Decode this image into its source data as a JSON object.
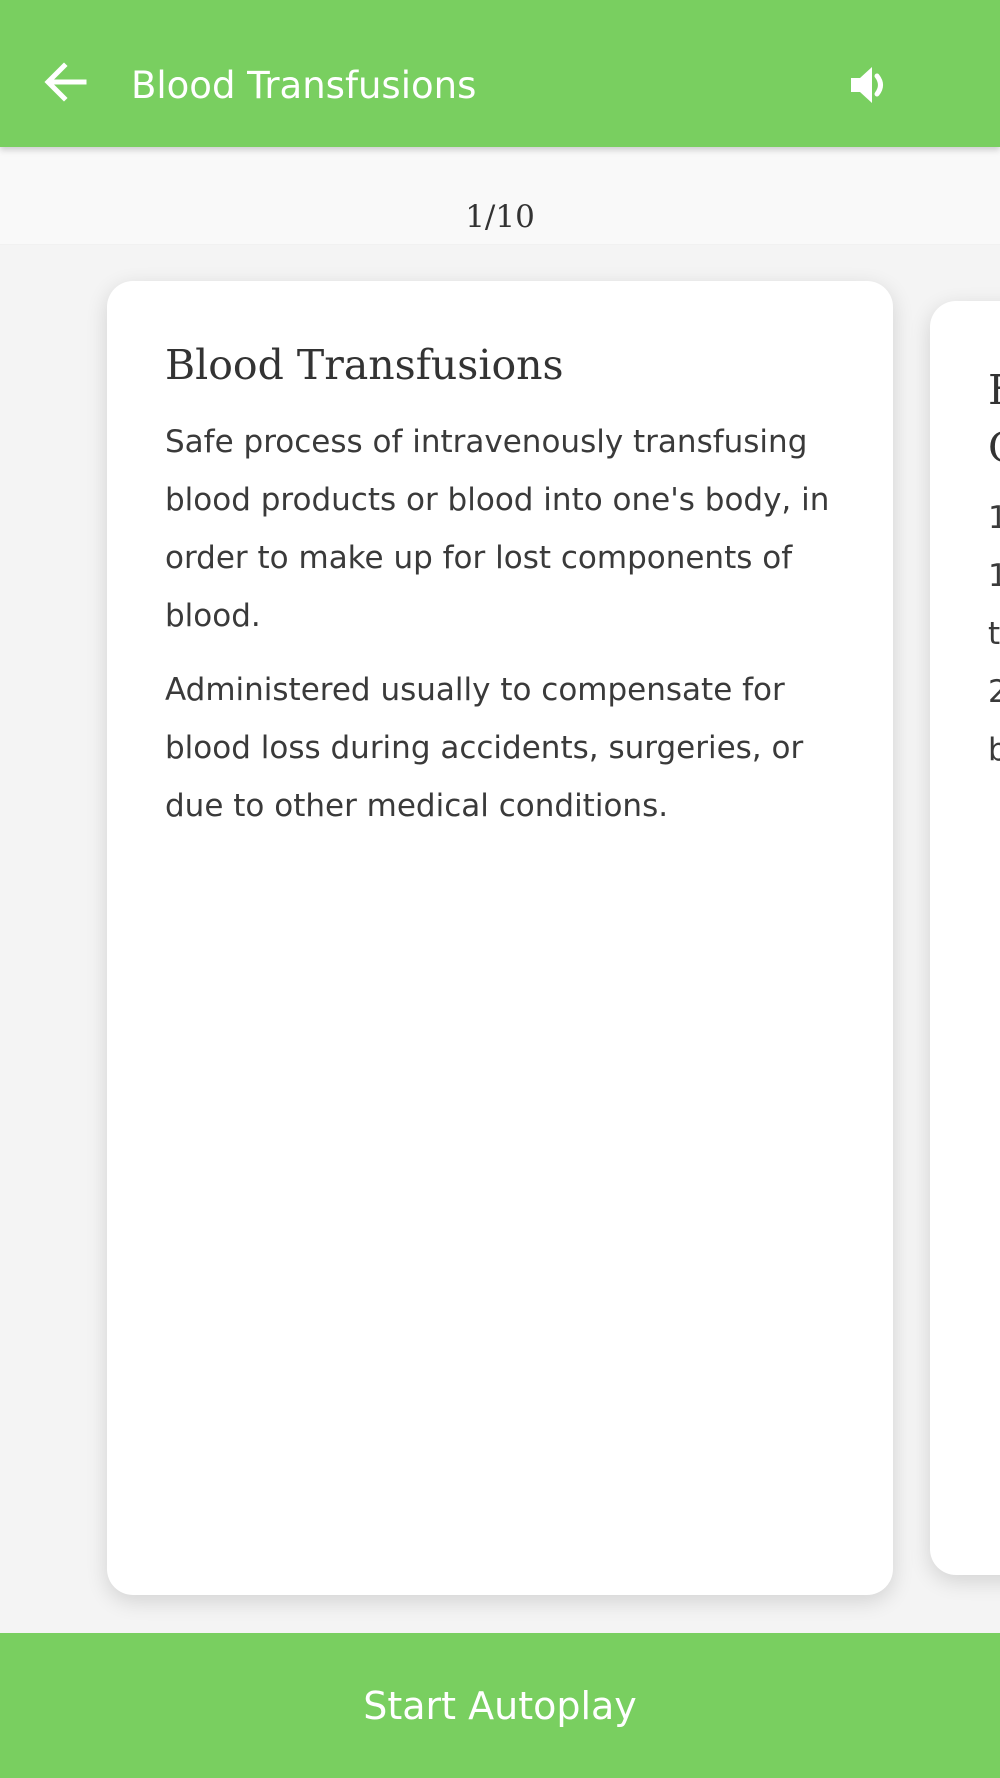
{
  "header": {
    "title": "Blood Transfusions",
    "back_icon": "arrow-left-icon",
    "sound_icon": "volume-icon",
    "background_color": "#79cf60"
  },
  "pager": {
    "counter": "1/10"
  },
  "cards": {
    "current": {
      "title": "Blood Transfusions",
      "paragraphs": [
        "Safe process of intravenously transfusing blood products or blood into one's body, in order to make up for lost components of blood.",
        "Administered usually to compensate for blood loss during accidents, surgeries, or due to other medical conditions."
      ]
    },
    "next_peek": {
      "title_lines": "F\nC",
      "text_lines": "1\n1\nt\n2\nb"
    }
  },
  "footer": {
    "autoplay_label": "Start Autoplay",
    "background_color": "#79cf60"
  }
}
